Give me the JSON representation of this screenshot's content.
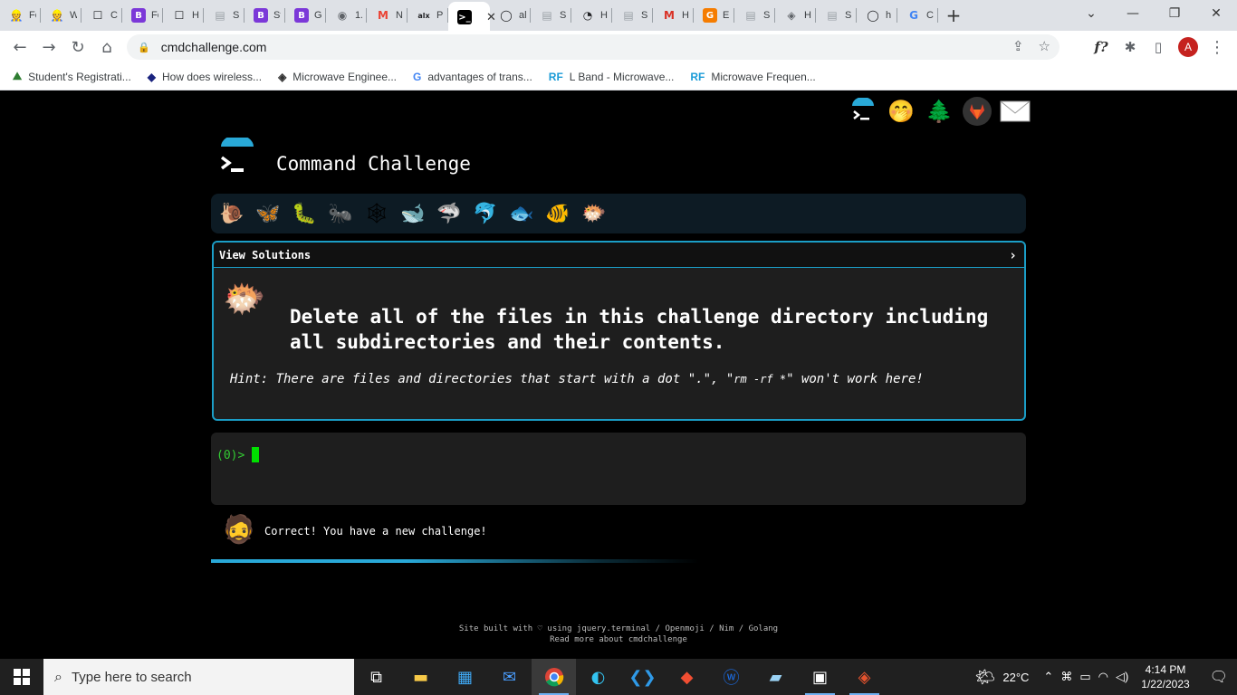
{
  "browser": {
    "tabs": [
      {
        "label": "Fo",
        "icon": "coder-icon",
        "color": "#c47a15"
      },
      {
        "label": "W",
        "icon": "coder-icon",
        "color": "#c47a15"
      },
      {
        "label": "C",
        "icon": "square-icon",
        "color": "#202124"
      },
      {
        "label": "Fo",
        "icon": "bootstrap-icon",
        "color": "#7b38d8"
      },
      {
        "label": "H",
        "icon": "square-icon",
        "color": "#202124"
      },
      {
        "label": "S",
        "icon": "document-icon",
        "color": "#9aa0a6"
      },
      {
        "label": "St",
        "icon": "bootstrap-icon",
        "color": "#7b38d8"
      },
      {
        "label": "G",
        "icon": "bootstrap-icon",
        "color": "#7b38d8"
      },
      {
        "label": "1.",
        "icon": "globe-icon",
        "color": "#5f6368"
      },
      {
        "label": "N",
        "icon": "gmail-icon",
        "color": "#ea4335"
      },
      {
        "label": "P",
        "icon": "alx-icon",
        "color": "#202124"
      },
      {
        "label": "",
        "icon": "terminal-icon",
        "color": "#000000",
        "active": true
      },
      {
        "label": "al",
        "icon": "github-icon",
        "color": "#202124"
      },
      {
        "label": "S",
        "icon": "document-icon",
        "color": "#9aa0a6"
      },
      {
        "label": "H",
        "icon": "circle-icon",
        "color": "#202124"
      },
      {
        "label": "S",
        "icon": "document-icon",
        "color": "#9aa0a6"
      },
      {
        "label": "H",
        "icon": "m-icon",
        "color": "#d93025"
      },
      {
        "label": "E",
        "icon": "g-orange-icon",
        "color": "#f57c00"
      },
      {
        "label": "S",
        "icon": "document-icon",
        "color": "#9aa0a6"
      },
      {
        "label": "H",
        "icon": "diamond-icon",
        "color": "#5f6368"
      },
      {
        "label": "S",
        "icon": "document-icon",
        "color": "#9aa0a6"
      },
      {
        "label": "h",
        "icon": "github-icon",
        "color": "#202124"
      },
      {
        "label": "C",
        "icon": "google-icon",
        "color": "#4285f4"
      }
    ],
    "url": "cmdchallenge.com",
    "bookmarks": [
      {
        "label": "Student's Registrati...",
        "icon": "tree-icon",
        "color": "#2e7d32"
      },
      {
        "label": "How does wireless...",
        "icon": "diamond-icon",
        "color": "#1a237e"
      },
      {
        "label": "Microwave Enginee...",
        "icon": "diamond-outline-icon",
        "color": "#333333"
      },
      {
        "label": "advantages of trans...",
        "icon": "google-icon",
        "color": "#4285f4"
      },
      {
        "label": "L Band - Microwave...",
        "icon": "rf-icon",
        "color": "#1a9bd7"
      },
      {
        "label": "Microwave Frequen...",
        "icon": "rf-icon",
        "color": "#1a9bd7"
      }
    ],
    "avatar_letter": "A"
  },
  "page": {
    "title": "Command Challenge",
    "view_solutions": "View Solutions",
    "challenge_text": "Delete all of the files in this challenge directory including all subdirectories and their contents.",
    "hint_prefix": "Hint: There are files and directories that start with a dot \".\", \"",
    "hint_code": "rm -rf *",
    "hint_suffix": "\" won't work here!",
    "prompt": "(0)>",
    "status_message": "Correct! You have a new challenge!",
    "footer_line1": "Site built with ♡ using jquery.terminal / Openmoji / Nim / Golang",
    "footer_line2": "Read more about cmdchallenge",
    "level_emojis": [
      "snail-icon",
      "butterfly-icon",
      "caterpillar-icon",
      "ant-icon",
      "spider-web-icon",
      "whale-icon",
      "shark-icon",
      "dolphin-icon",
      "fish-icon",
      "tropical-fish-icon",
      "blowfish-icon"
    ],
    "accent_color": "#1b9ec7",
    "progress_fraction": 0.45
  },
  "taskbar": {
    "search_placeholder": "Type here to search",
    "temperature": "22°C",
    "time": "4:14 PM",
    "date": "1/22/2023"
  }
}
